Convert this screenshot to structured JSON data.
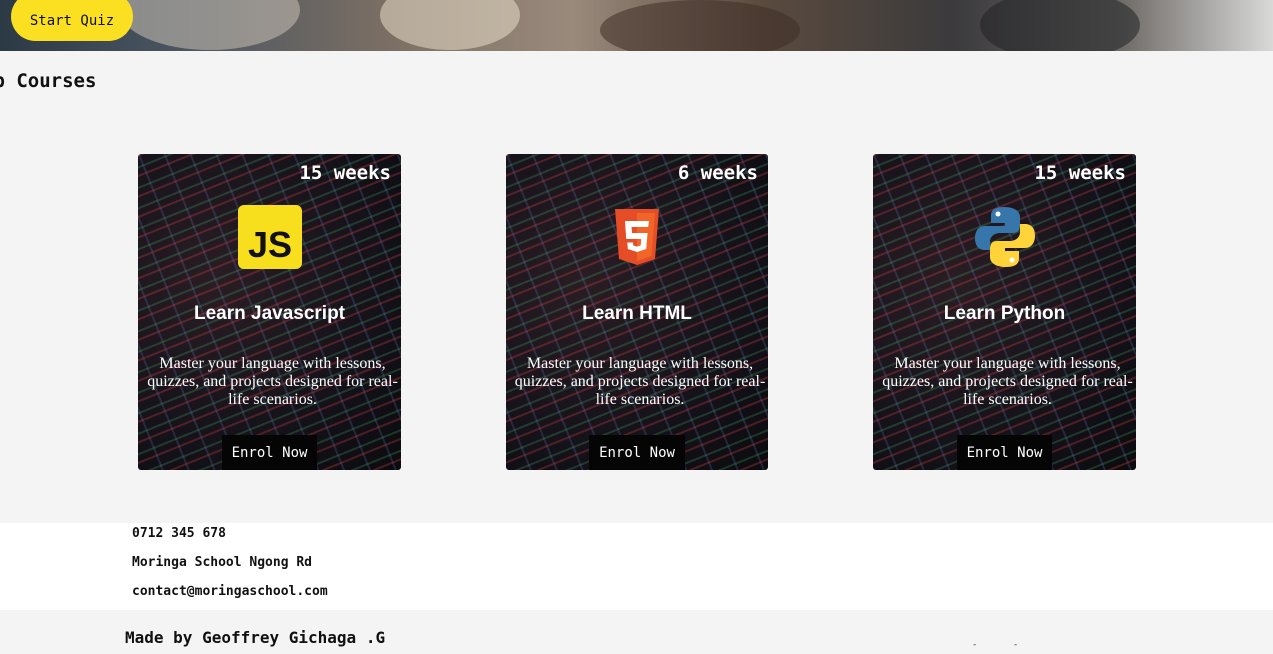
{
  "hero": {
    "start_label": "Start Quiz"
  },
  "section": {
    "title": "op Courses"
  },
  "courses": [
    {
      "weeks": "15 weeks",
      "logo": "javascript-logo",
      "title": "Learn Javascript",
      "desc": "Master your language with lessons, quizzes, and projects designed for real-life scenarios.",
      "button": "Enrol Now"
    },
    {
      "weeks": "6 weeks",
      "logo": "html5-logo",
      "title": "Learn HTML",
      "desc": "Master your language with lessons, quizzes, and projects designed for real-life scenarios.",
      "button": "Enrol Now"
    },
    {
      "weeks": "15 weeks",
      "logo": "python-logo",
      "title": "Learn Python",
      "desc": "Master your language with lessons, quizzes, and projects designed for real-life scenarios.",
      "button": "Enrol Now"
    }
  ],
  "contact": {
    "phone": "0712 345 678",
    "address": "Moringa School Ngong Rd",
    "email": "contact@moringaschool.com"
  },
  "footer": {
    "made_by": "Made by Geoffrey Gichaga .G",
    "dots": "- -"
  },
  "colors": {
    "accent": "#fbe022",
    "js": "#f7df1e",
    "html": "#e44d26",
    "python_blue": "#3776ab",
    "python_yellow": "#ffd43b"
  }
}
